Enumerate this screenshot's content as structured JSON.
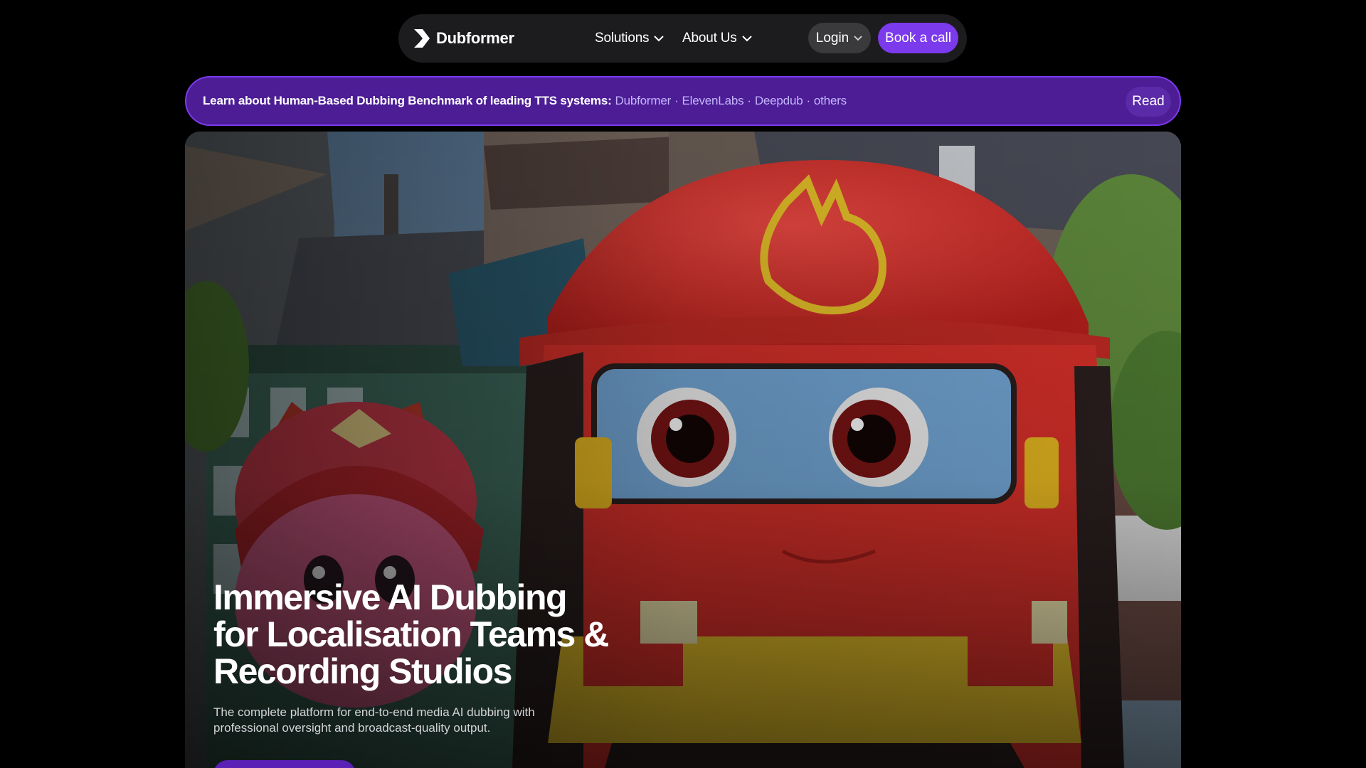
{
  "nav": {
    "brand": "Dubformer",
    "solutions_label": "Solutions",
    "about_label": "About Us",
    "login_label": "Login",
    "book_label": "Book a call"
  },
  "banner": {
    "text": "Learn about Human-Based Dubbing Benchmark of leading TTS systems:",
    "links": [
      "Dubformer",
      "ElevenLabs",
      "Deepdub",
      "others"
    ],
    "separator": "·",
    "read_label": "Read"
  },
  "hero": {
    "title_lines": [
      "Immersive AI Dubbing",
      "for Localisation Teams &",
      "Recording Studios"
    ],
    "subtitle_lines": [
      "The complete platform for end-to-end media AI dubbing with",
      "professional oversight and broadcast-quality output."
    ]
  },
  "colors": {
    "accent": "#7c3aed",
    "banner_bg": "#4c1d95",
    "banner_link": "#c4b5fd",
    "nav_bg": "#1c1c1e"
  },
  "icons": {
    "logo": "dubformer-logo-icon",
    "dropdown": "chevron-down-icon"
  }
}
